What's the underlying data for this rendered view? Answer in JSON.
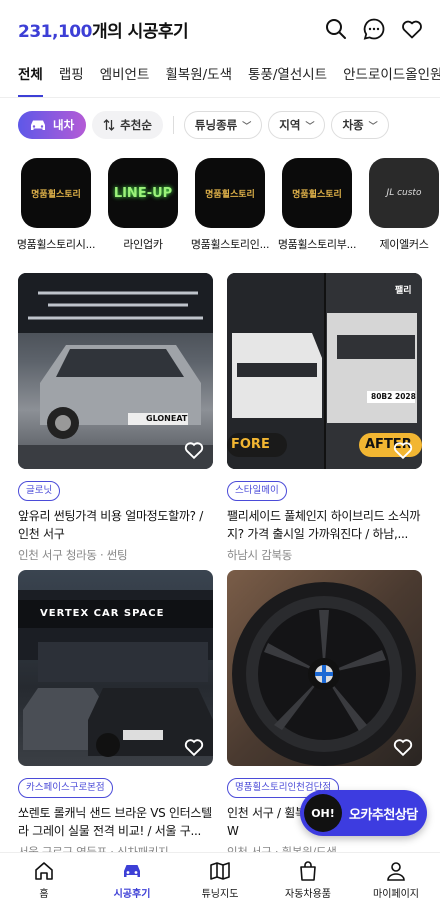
{
  "header": {
    "count": "231,100",
    "title_suffix": "개의 시공후기",
    "icons": [
      "search-icon",
      "chat-icon",
      "heart-icon"
    ]
  },
  "tabs": [
    {
      "label": "전체",
      "active": true
    },
    {
      "label": "랩핑"
    },
    {
      "label": "엠비언트"
    },
    {
      "label": "휠복원/도색"
    },
    {
      "label": "통풍/열선시트"
    },
    {
      "label": "안드로이드올인원"
    }
  ],
  "filters": {
    "vehicle_label": "내차",
    "sort_label": "추천순",
    "tuning_label": "튜닝종류",
    "region_label": "지역",
    "model_label": "차종"
  },
  "shops": [
    {
      "name": "명품휠스토리시...",
      "logo_text": "명품휠스토리"
    },
    {
      "name": "라인업카",
      "logo_text": "LINE-UP"
    },
    {
      "name": "명품휠스토리인...",
      "logo_text": "명품휠스토리"
    },
    {
      "name": "명품휠스토리부...",
      "logo_text": "명품휠스토리"
    },
    {
      "name": "제이엘커스",
      "logo_text": "JL custo"
    }
  ],
  "cards": [
    {
      "badge": "글로닛",
      "title": "앞유리 썬팅가격 비용 얼마정도할까? / 인천 서구",
      "meta": "인천 서구 청라동 · 썬팅",
      "photo_text": "GLONEAT"
    },
    {
      "badge": "스타일메이",
      "title": "팰리세이드 풀체인지 하이브리드 소식까지? 가격 출시일 가까워진다 / 하남,...",
      "meta": "하남시 감북동",
      "before_label": "FORE",
      "after_label": "AFTER",
      "plate_text": "80B2 2028",
      "brand_text": "팰리"
    },
    {
      "badge": "카스페이스구로본점",
      "title": "쏘렌토 롤캐닉 샌드 브라운 VS 인터스텔라 그레이 실물 전격 비교! / 서울 구...",
      "meta": "서울 구로구 영등포 · 신차패키지",
      "sign_text": "VERTEX  CAR SPACE"
    },
    {
      "badge": "명품휠스토리인천검단점",
      "title": "인천 서구 / 휠복원 / 휠도색 / 휠블랙 / W",
      "meta": "인천 서구 · 휠복원/도색"
    }
  ],
  "fab": {
    "circle_text": "OH!",
    "label": "오카추천상담"
  },
  "bottom_nav": [
    {
      "label": "홈",
      "icon": "home-icon"
    },
    {
      "label": "시공후기",
      "icon": "car-icon",
      "active": true
    },
    {
      "label": "튜닝지도",
      "icon": "map-icon"
    },
    {
      "label": "자동차용품",
      "icon": "shopping-bag-icon"
    },
    {
      "label": "마이페이지",
      "icon": "user-icon"
    }
  ],
  "colors": {
    "accent": "#3d3fd6",
    "fab": "#3d3ce0",
    "badge": "#4b4bd8"
  }
}
